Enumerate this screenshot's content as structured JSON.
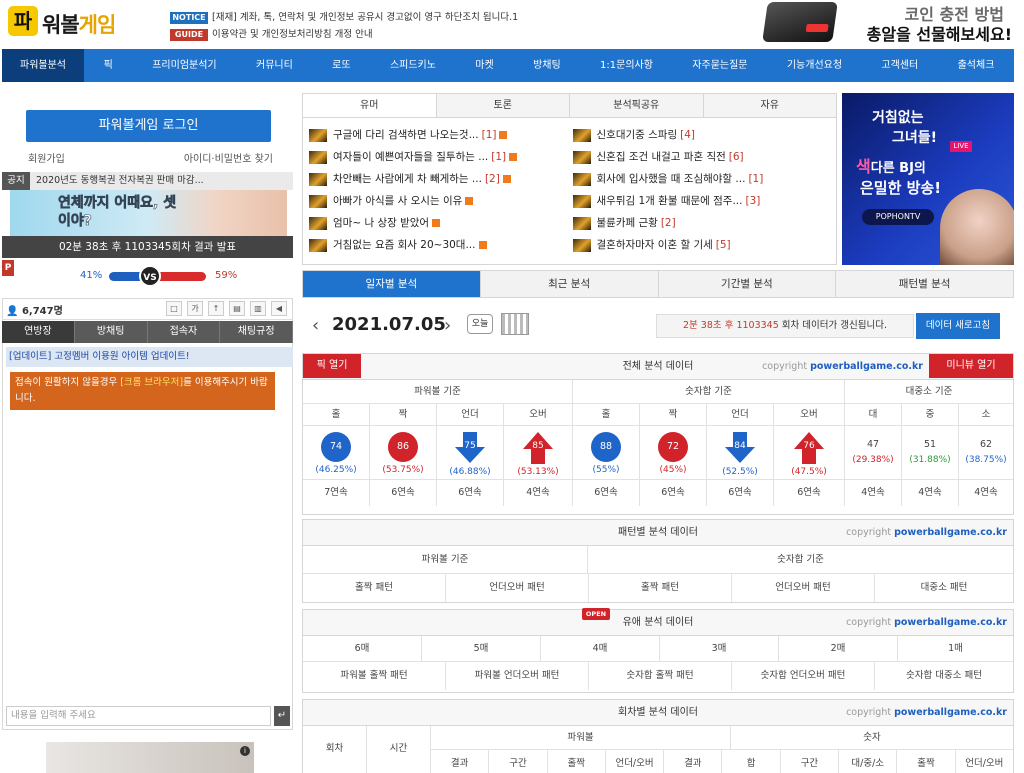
{
  "header": {
    "logo_badge": "파",
    "logo_main": "워볼",
    "logo_accent": "게임",
    "notices": [
      {
        "tag": "NOTICE",
        "text": "[재재] 계좌, 톡, 연락처 및 개인정보 공유시 경고없이 영구 하단조치 됩니다.1"
      },
      {
        "tag": "GUIDE",
        "text": "이용약관 및 개인정보처리방침 개정 안내"
      }
    ],
    "ad_line1": "코인 충전 방법",
    "ad_line2": "총알을 선물해보세요!"
  },
  "nav": [
    "파워볼분석",
    "픽",
    "프리미엄분석기",
    "커뮤니티",
    "로또",
    "스피드키노",
    "마켓",
    "방채팅",
    "1:1문의사항",
    "자주묻는질문",
    "기능개선요청",
    "고객센터",
    "출석체크"
  ],
  "login": {
    "button": "파워볼게임 로그인",
    "signup": "회원가입",
    "find": "아이디·비밀번호 찾기",
    "notice_label": "공지",
    "notice_text": "2020년도 동행복권 전자복권 판매 마감..."
  },
  "banner_text": "연체까지 어때요, 셋이야?",
  "result": {
    "text": "02분 38초 후 1103345회차 결과 발표",
    "left_pct": "41%",
    "right_pct": "59%",
    "vs": "VS",
    "p_mark": "P",
    "left_ratio": 0.41
  },
  "chat": {
    "count": "6,747명",
    "tools": [
      "□",
      "가",
      "↑",
      "▤",
      "▥",
      "◀"
    ],
    "tabs": [
      "연방장",
      "방채팅",
      "접속자",
      "채팅규정"
    ],
    "update": "[업데이트] 고정멤버 이용원 아이템 업데이트!",
    "warn_pre": "접속이 원활하지 않을경우 ",
    "warn_hl": "[크롬 브라우저]",
    "warn_post": "를 이용해주시기 바랍니다.",
    "input_placeholder": "내용을 입력해 주세요",
    "send": "↵"
  },
  "board": {
    "tabs": [
      "유머",
      "토론",
      "분석픽공유",
      "자유"
    ],
    "left_posts": [
      {
        "title": "구글에 다리 검색하면 나오는것...",
        "count": "[1]",
        "new": true
      },
      {
        "title": "여자들이 예쁜여자들을 질투하는 ...",
        "count": "[1]",
        "new": true
      },
      {
        "title": "차안빼는 사람에게 차 빼게하는 ...",
        "count": "[2]",
        "new": true
      },
      {
        "title": "아빠가 아식를 사 오시는 이유",
        "count": "",
        "new": true
      },
      {
        "title": "엄마~ 나 상장 받았어",
        "count": "",
        "new": true
      },
      {
        "title": "거침없는 요즘 회사 20~30대...",
        "count": "",
        "new": true
      }
    ],
    "right_posts": [
      {
        "title": "신호대기중 스파링",
        "count": "[4]",
        "new": false
      },
      {
        "title": "신혼집 조건 내걸고 파혼 직전",
        "count": "[6]",
        "new": false
      },
      {
        "title": "회사에 입사했을 때 조심해야할 ...",
        "count": "[1]",
        "new": false
      },
      {
        "title": "새우튀김 1개 환불 때문에 점주...",
        "count": "[3]",
        "new": false
      },
      {
        "title": "불륜카페 근황",
        "count": "[2]",
        "new": false
      },
      {
        "title": "결혼하자마자 이혼 할 기세",
        "count": "[5]",
        "new": false
      }
    ]
  },
  "side_ad": {
    "line1": "거침없는",
    "line2": "그녀들!",
    "line3a": "색",
    "line3b": "다른 BJ의",
    "line4": "은밀한 방송!",
    "pill": "POPHONTV",
    "live": "LIVE"
  },
  "analysis_tabs": [
    "일자별 분석",
    "최근 분석",
    "기간별 분석",
    "패턴별 분석"
  ],
  "date_row": {
    "date": "2021.07.05",
    "prev": "‹",
    "next": "›",
    "today": "오늘",
    "info_time": "2분 38초 후",
    "info_round": "1103345",
    "info_rest": " 회차 데이터가 갱신됩니다.",
    "refresh": "데이터 새로고침"
  },
  "total_section": {
    "title": "전체 분석 데이터",
    "pick_open": "픽 열기",
    "mini_open": "미니뷰 열기",
    "copyright_pre": "copyright ",
    "copyright_site": "powerballgame.co.kr",
    "group_headers": [
      "파워볼 기준",
      "숫자합 기준",
      "대중소 기준"
    ],
    "col_headers": [
      "홀",
      "짝",
      "언더",
      "오버",
      "홀",
      "짝",
      "언더",
      "오버",
      "대",
      "중",
      "소"
    ],
    "values": [
      "74",
      "86",
      "75",
      "85",
      "88",
      "72",
      "84",
      "76",
      "47",
      "51",
      "62"
    ],
    "percents": [
      "(46.25%)",
      "(53.75%)",
      "(46.88%)",
      "(53.13%)",
      "(55%)",
      "(45%)",
      "(52.5%)",
      "(47.5%)",
      "(29.38%)",
      "(31.88%)",
      "(38.75%)"
    ],
    "streaks": [
      "7연속",
      "6연속",
      "6연속",
      "4연속",
      "6연속",
      "6연속",
      "6연속",
      "6연속",
      "4연속",
      "4연속",
      "4연속"
    ]
  },
  "pattern_section": {
    "title": "패턴별 분석 데이터",
    "copyright_pre": "copyright ",
    "copyright_site": "powerballgame.co.kr",
    "group_headers": [
      "파워볼 기준",
      "숫자합 기준"
    ],
    "items": [
      "홀짝 패턴",
      "언더오버 패턴",
      "홀짝 패턴",
      "언더오버 패턴",
      "대중소 패턴"
    ]
  },
  "unit_section": {
    "title": "유애 분석 데이터",
    "open_badge": "OPEN",
    "copyright_pre": "copyright ",
    "copyright_site": "powerballgame.co.kr",
    "units": [
      "6매",
      "5매",
      "4매",
      "3매",
      "2매",
      "1매"
    ],
    "items": [
      "파워볼 홀짝 패턴",
      "파워볼 언더오버 패턴",
      "숫자합 홀짝 패턴",
      "숫자합 언더오버 패턴",
      "숫자합 대중소 패턴"
    ]
  },
  "round_section": {
    "title": "회차별 분석 데이터",
    "copyright_pre": "copyright ",
    "copyright_site": "powerballgame.co.kr",
    "head1": [
      "회차",
      "시간",
      "파워볼",
      "숫자"
    ],
    "head2": [
      "결과",
      "구간",
      "홀짝",
      "언더/오버",
      "결과",
      "합",
      "구간",
      "대/중/소",
      "홀짝",
      "언더/오버"
    ]
  }
}
